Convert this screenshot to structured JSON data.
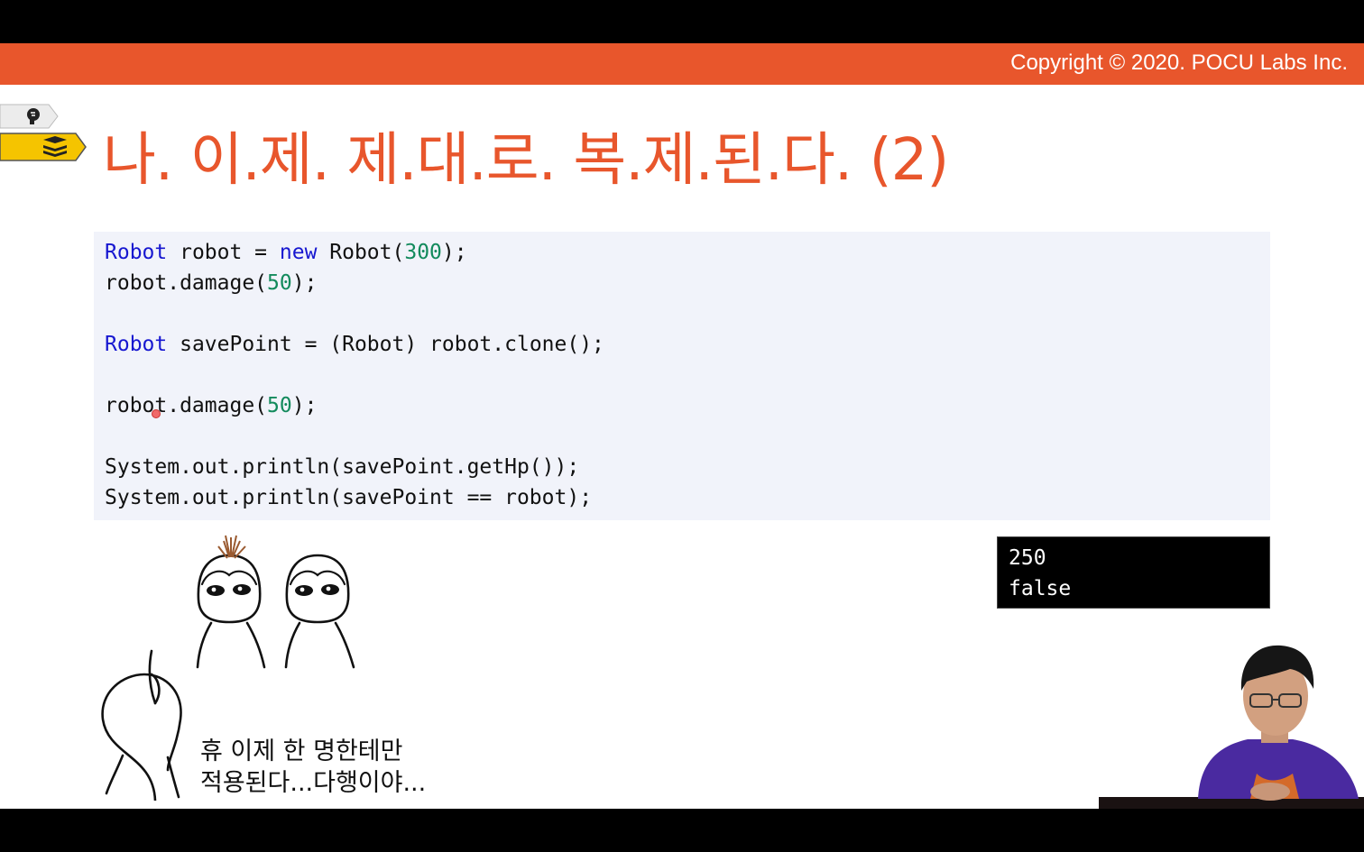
{
  "header": {
    "copyright": "Copyright © 2020. POCU Labs Inc."
  },
  "slide": {
    "title": "나. 이.제. 제.대.로. 복.제.된.다. (2)"
  },
  "code": {
    "line1": {
      "t1": "Robot",
      "t2": " robot = ",
      "t3": "new",
      "t4": " Robot(",
      "t5": "300",
      "t6": ");"
    },
    "line2": {
      "t1": "robot.damage(",
      "t2": "50",
      "t3": ");"
    },
    "line4": {
      "t1": "Robot",
      "t2": " savePoint = (Robot) robot.clone();"
    },
    "line6": {
      "t1": "robot.damage(",
      "t2": "50",
      "t3": ");"
    },
    "line8": "System.out.println(savePoint.getHp());",
    "line9": "System.out.println(savePoint == robot);"
  },
  "output": {
    "lines": [
      "250",
      "false"
    ]
  },
  "caption": {
    "line1": "휴 이제 한 명한테만",
    "line2": "적용된다...다행이야..."
  },
  "colors": {
    "accent": "#e8562c",
    "keyword": "#1717d0",
    "number": "#128a5c",
    "code_bg": "#f1f3fa"
  },
  "icons": [
    "brain-icon",
    "book-stack-icon"
  ]
}
